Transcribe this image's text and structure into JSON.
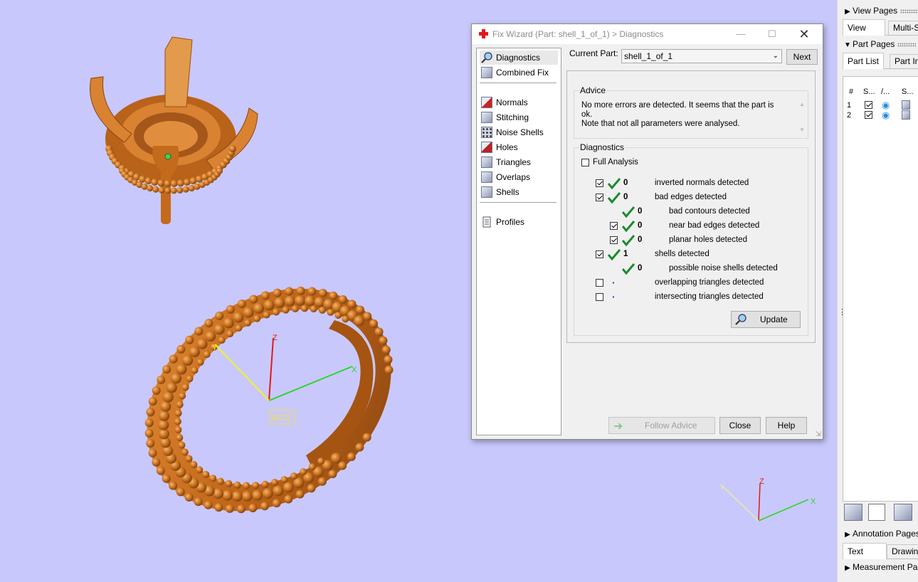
{
  "viewport": {
    "wcs_label": "WCS",
    "axes": {
      "x": "X",
      "y": "Y",
      "z": "Z"
    },
    "colors": {
      "background": "#c9c8fc",
      "model": "#c8701e"
    }
  },
  "right_panel": {
    "view_pages": "View Pages",
    "view_tabs": [
      "View",
      "Multi-Se"
    ],
    "part_pages": "Part Pages",
    "part_tabs": [
      "Part List",
      "Part In"
    ],
    "columns": [
      "#",
      "S...",
      "/...",
      "S..."
    ],
    "rows": [
      {
        "num": "1"
      },
      {
        "num": "2"
      }
    ],
    "annotation_pages": "Annotation Pages",
    "annotation_tabs": [
      "Text",
      "Drawing"
    ],
    "measurement_pages": "Measurement Pages"
  },
  "dialog": {
    "title": "Fix Wizard (Part: shell_1_of_1) > Diagnostics",
    "nav": [
      {
        "label": "Diagnostics",
        "icon": "magnifier-icon"
      },
      {
        "label": "Combined Fix",
        "icon": "combined-fix-icon"
      },
      {
        "label": "Normals",
        "icon": "normals-icon"
      },
      {
        "label": "Stitching",
        "icon": "stitching-icon"
      },
      {
        "label": "Noise Shells",
        "icon": "noise-shells-icon"
      },
      {
        "label": "Holes",
        "icon": "holes-icon"
      },
      {
        "label": "Triangles",
        "icon": "triangles-icon"
      },
      {
        "label": "Overlaps",
        "icon": "overlaps-icon"
      },
      {
        "label": "Shells",
        "icon": "shells-icon"
      },
      {
        "label": "Profiles",
        "icon": "document-icon"
      }
    ],
    "current_part_label": "Current Part:",
    "current_part_value": "shell_1_of_1",
    "next_button": "Next",
    "advice_title": "Advice",
    "advice_line1": "No more errors are detected. It seems that the part is ok.",
    "advice_line2": "Note that not all parameters were analysed.",
    "diagnostics_title": "Diagnostics",
    "full_analysis": "Full Analysis",
    "rows": [
      {
        "count": "0",
        "text": "inverted normals detected"
      },
      {
        "count": "0",
        "text": "bad edges detected"
      },
      {
        "count": "0",
        "text": "bad contours detected"
      },
      {
        "count": "0",
        "text": "near bad edges detected"
      },
      {
        "count": "0",
        "text": "planar holes detected"
      },
      {
        "count": "1",
        "text": "shells detected"
      },
      {
        "count": "0",
        "text": "possible noise shells detected"
      },
      {
        "count": "",
        "text": "overlapping triangles detected"
      },
      {
        "count": "",
        "text": "intersecting triangles detected"
      }
    ],
    "update_button": "Update",
    "follow_advice": "Follow Advice",
    "close_button": "Close",
    "help_button": "Help",
    "colors": {
      "check": "#1c8a2e",
      "dot": "#1f3fd6"
    }
  }
}
